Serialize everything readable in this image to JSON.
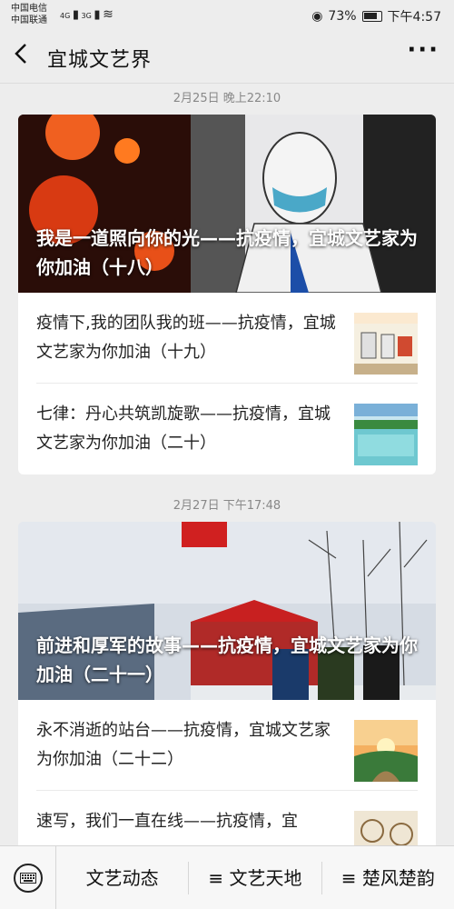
{
  "status_bar": {
    "carrier1": "中国电信",
    "carrier2": "中国联通",
    "signal1": "4G",
    "signal2": "3G",
    "battery": "73%",
    "time": "下午4:57"
  },
  "header": {
    "title": "宜城文艺界",
    "back_icon": "back-chevron",
    "more_icon": "more-dots",
    "more_label": "···"
  },
  "groups": [
    {
      "time": "2月25日 晚上22:10",
      "cover_title": "我是一道照向你的光——抗疫情，宜城文艺家为你加油（十八）",
      "items": [
        {
          "title": "疫情下,我的团队我的班——抗疫情，宜城文艺家为你加油（十九）"
        },
        {
          "title": "七律：丹心共筑凯旋歌——抗疫情，宜城文艺家为你加油（二十）"
        }
      ]
    },
    {
      "time": "2月27日 下午17:48",
      "cover_title": "前进和厚军的故事——抗疫情，宜城文艺家为你加油（二十一）",
      "items": [
        {
          "title": "永不消逝的站台——抗疫情，宜城文艺家为你加油（二十二）"
        },
        {
          "title": "速写，我们一直在线——抗疫情，宜"
        }
      ]
    }
  ],
  "menu": {
    "keyboard_icon": "keyboard-icon",
    "item1": "文艺动态",
    "item2": "≡ 文艺天地",
    "item3": "≡ 楚风楚韵"
  }
}
